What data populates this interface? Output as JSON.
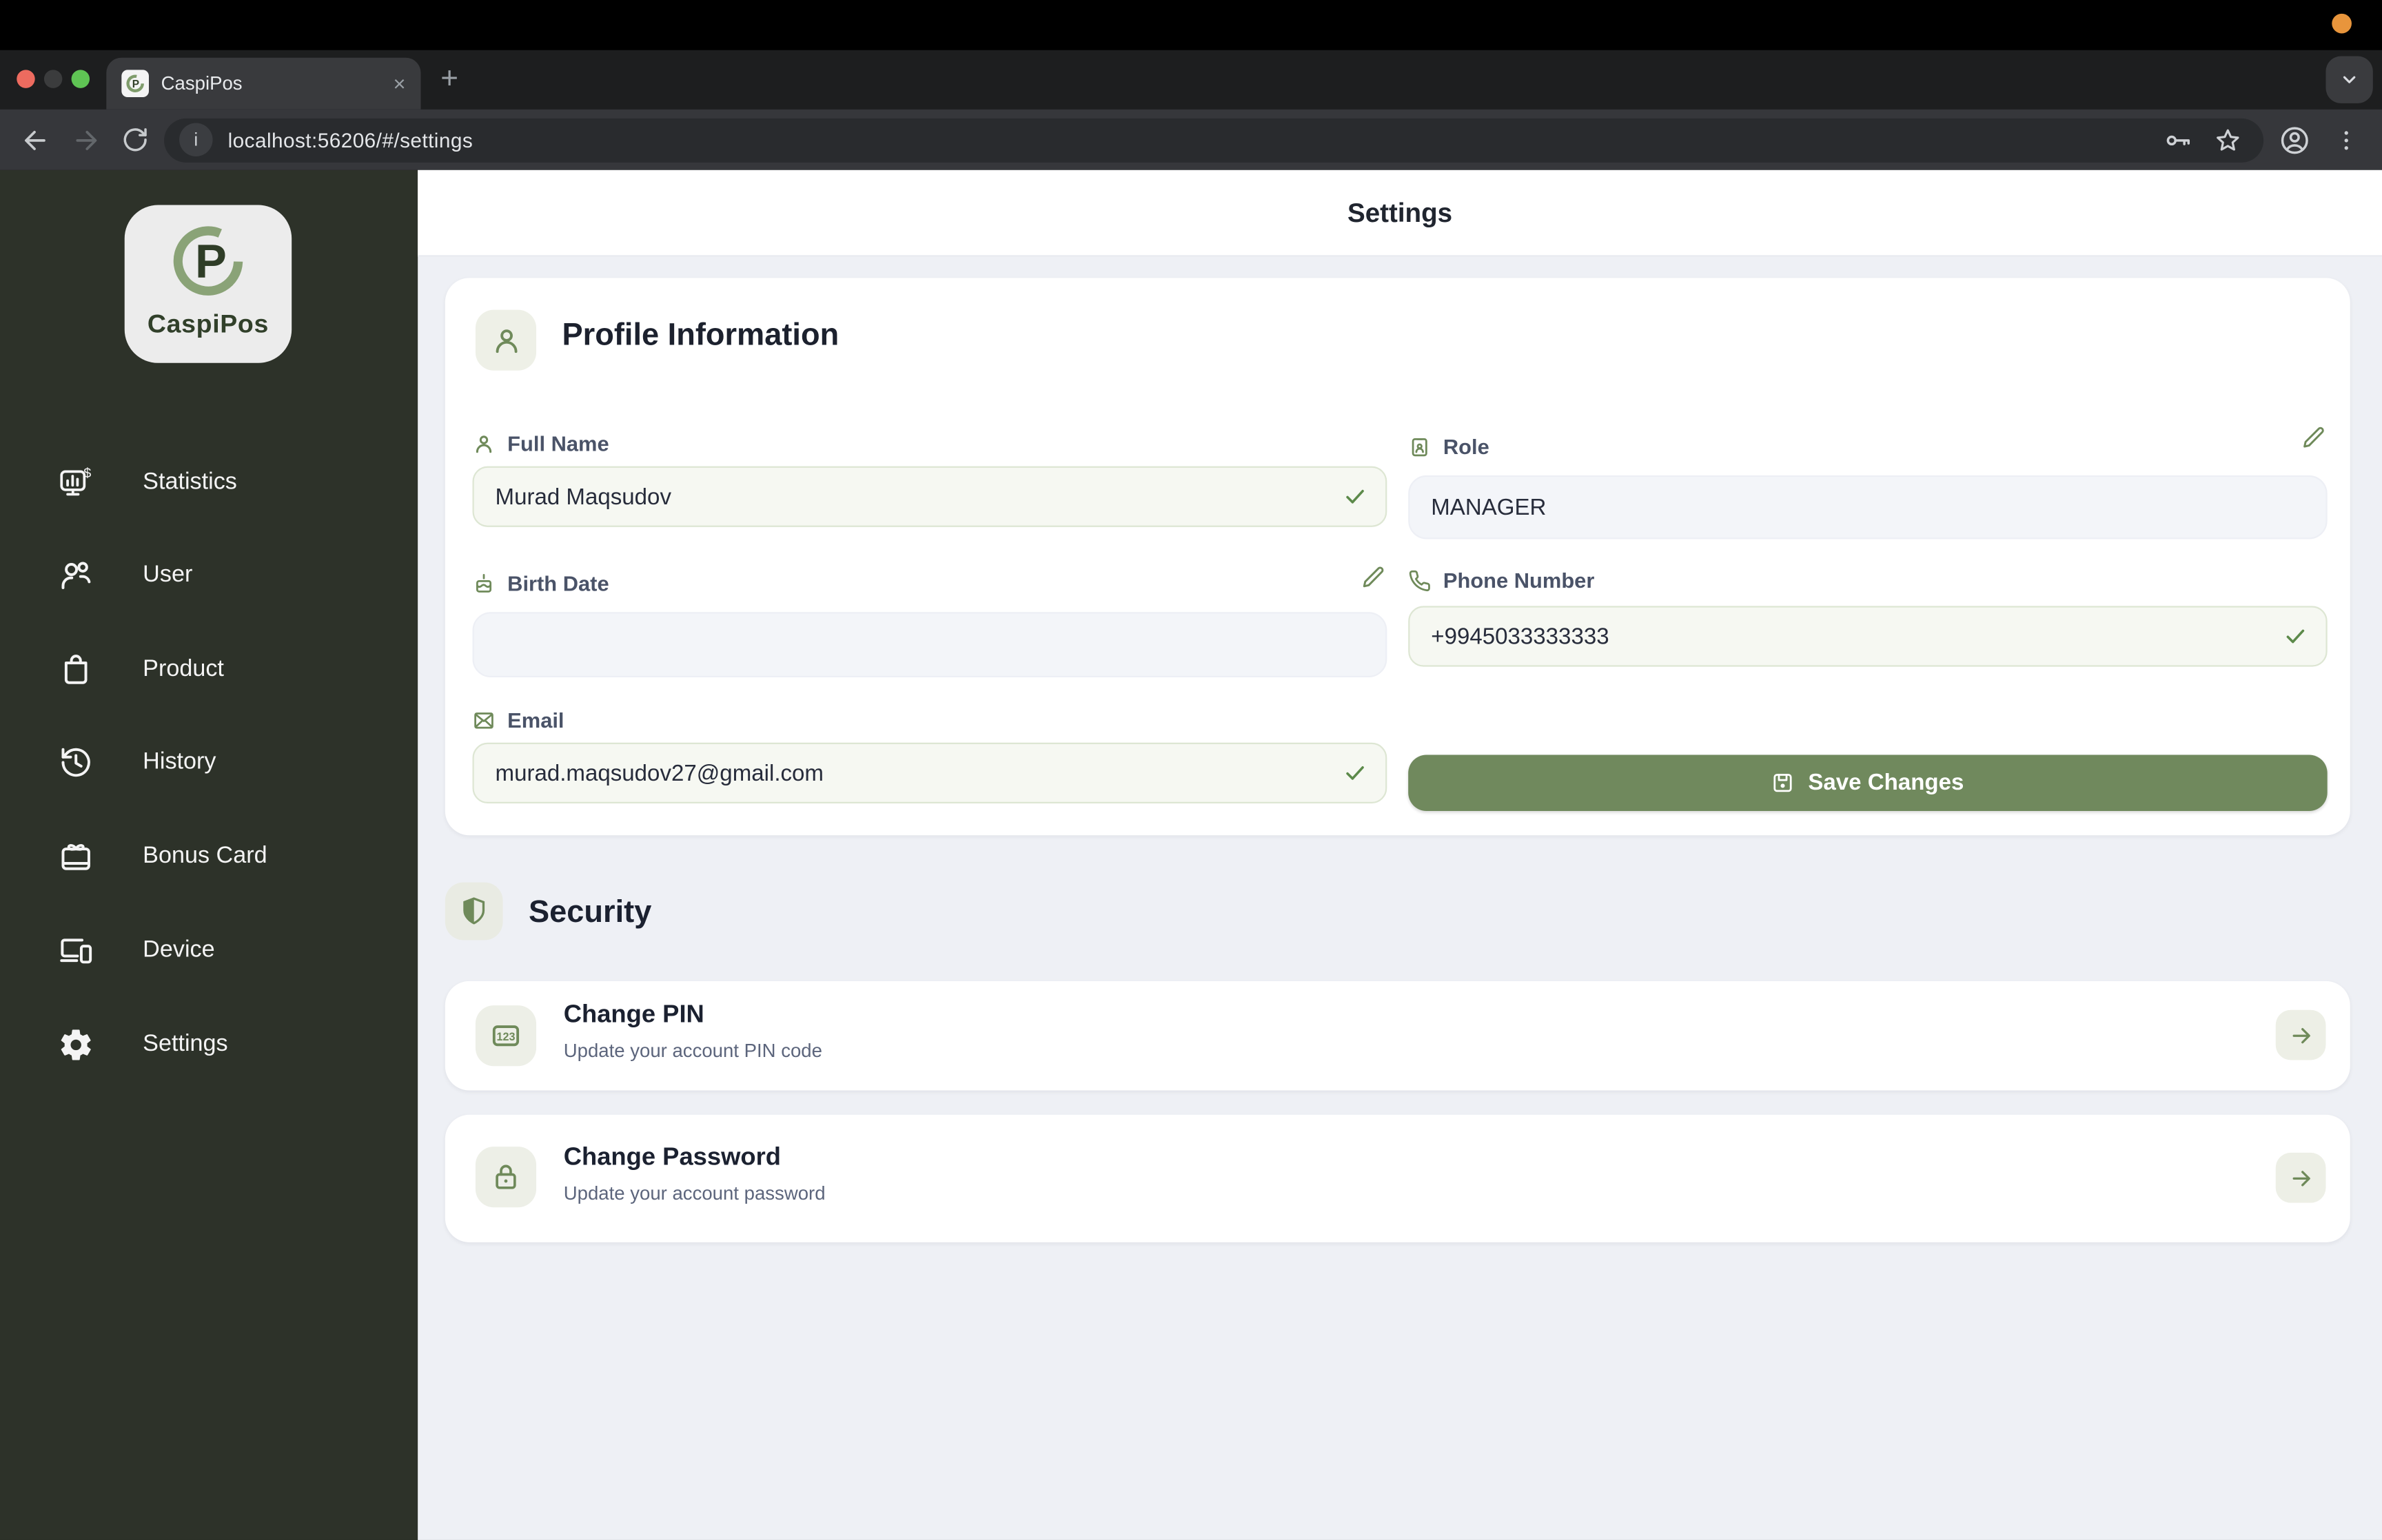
{
  "browser": {
    "tab": {
      "title": "CaspiPos",
      "close_label": "×"
    },
    "new_tab_label": "+",
    "info_glyph": "i",
    "url": "localhost:56206/#/settings"
  },
  "sidebar": {
    "logo_text": "CaspiPos",
    "items": [
      {
        "label": "Statistics"
      },
      {
        "label": "User"
      },
      {
        "label": "Product"
      },
      {
        "label": "History"
      },
      {
        "label": "Bonus Card"
      },
      {
        "label": "Device"
      },
      {
        "label": "Settings"
      }
    ]
  },
  "page": {
    "title": "Settings"
  },
  "profile": {
    "title": "Profile Information",
    "full_name": {
      "label": "Full Name",
      "value": "Murad Maqsudov"
    },
    "role": {
      "label": "Role",
      "value": "MANAGER"
    },
    "birth_date": {
      "label": "Birth Date",
      "value": ""
    },
    "phone": {
      "label": "Phone Number",
      "value": "+9945033333333"
    },
    "email": {
      "label": "Email",
      "value": "murad.maqsudov27@gmail.com"
    },
    "save_label": "Save Changes"
  },
  "security": {
    "title": "Security",
    "items": [
      {
        "title": "Change PIN",
        "subtitle": "Update your account PIN code"
      },
      {
        "title": "Change Password",
        "subtitle": "Update your account password"
      }
    ]
  },
  "colors": {
    "accent_green": "#6f8a5a",
    "button_green": "#70895d",
    "sidebar_bg": "#2d3229",
    "content_bg": "#eef0f5",
    "verified_field_bg": "#f6f8f2",
    "plain_field_bg": "#f3f5f9"
  }
}
